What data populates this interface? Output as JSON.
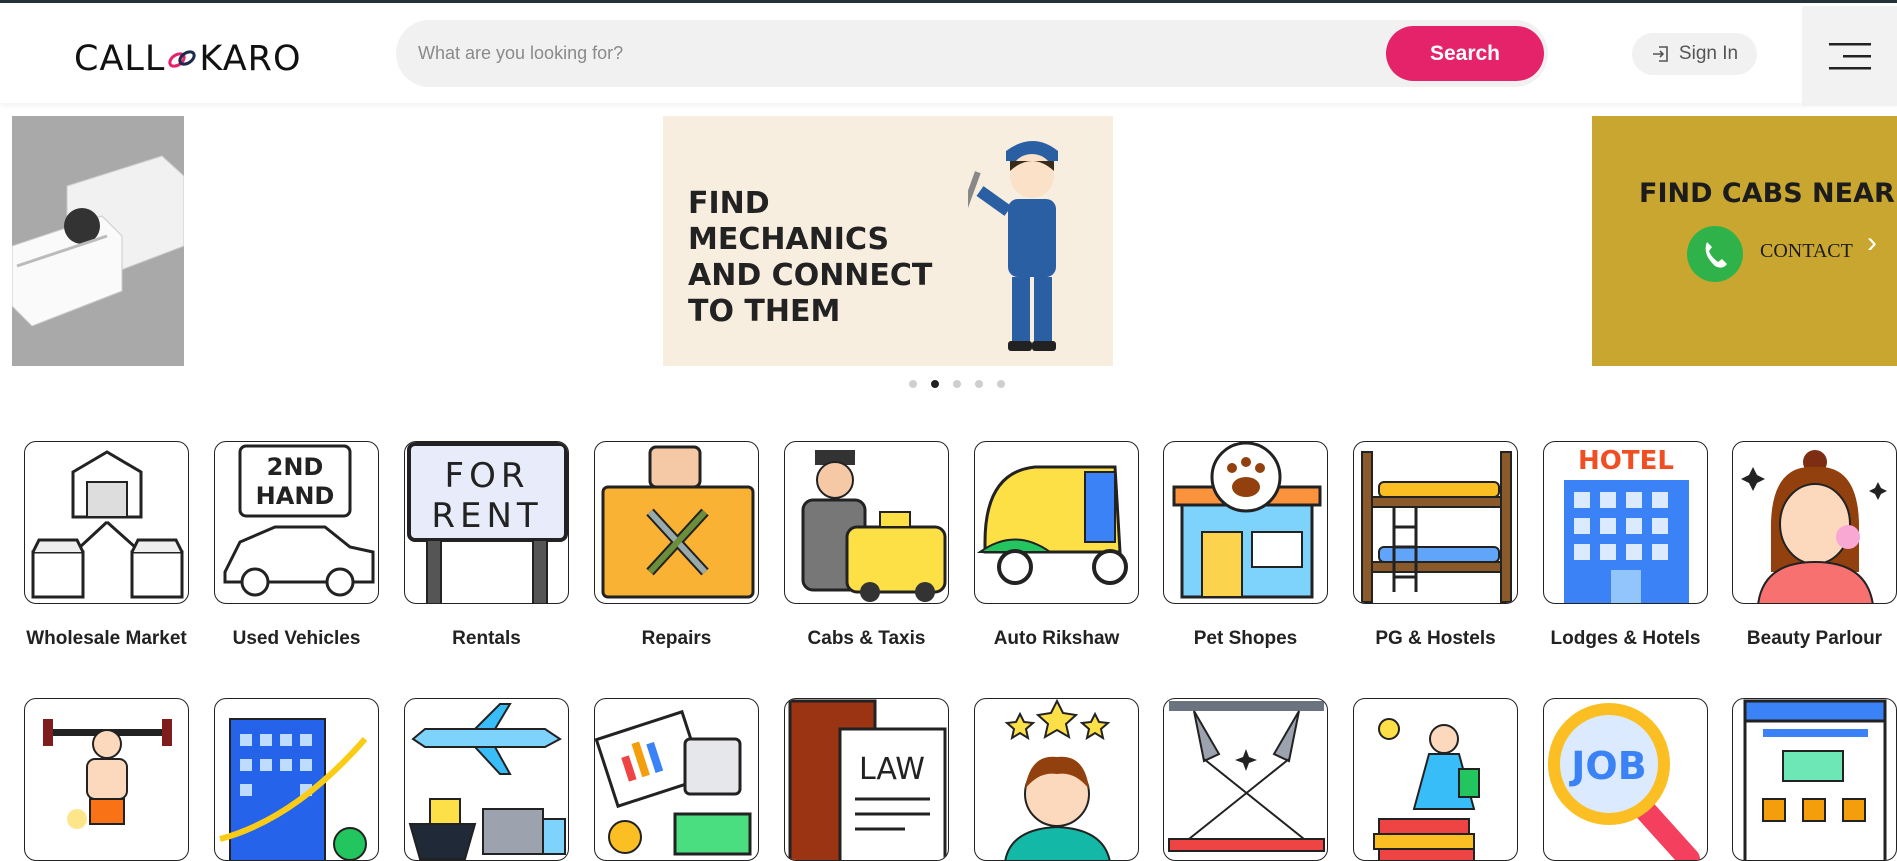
{
  "header": {
    "logo_left": "CALL",
    "logo_right": "KARO",
    "search_placeholder": "What are you looking for?",
    "search_button": "Search",
    "signin_label": "Sign In"
  },
  "banners": {
    "mechanics_text": "FIND MECHANICS AND CONNECT TO THEM",
    "cabs_text": "FIND CABS NEAR YO",
    "cabs_contact": "CONTACT"
  },
  "carousel": {
    "total": 5,
    "active": 2
  },
  "categories_row1": [
    {
      "label": "Wholesale Market",
      "icon": "warehouse-icon"
    },
    {
      "label": "Used Vehicles",
      "icon": "second-hand-car-icon"
    },
    {
      "label": "Rentals",
      "icon": "for-rent-sign-icon"
    },
    {
      "label": "Repairs",
      "icon": "toolbox-icon"
    },
    {
      "label": "Cabs & Taxis",
      "icon": "taxi-driver-icon"
    },
    {
      "label": "Auto Rikshaw",
      "icon": "auto-rickshaw-icon"
    },
    {
      "label": "Pet Shopes",
      "icon": "pet-shop-icon"
    },
    {
      "label": "PG & Hostels",
      "icon": "bunk-bed-icon"
    },
    {
      "label": "Lodges & Hotels",
      "icon": "hotel-icon"
    },
    {
      "label": "Beauty Parlour",
      "icon": "beauty-icon"
    }
  ],
  "categories_row2": [
    {
      "icon": "gym-icon"
    },
    {
      "icon": "real-estate-icon"
    },
    {
      "icon": "transport-icon"
    },
    {
      "icon": "accounting-icon"
    },
    {
      "icon": "law-book-icon",
      "text": "LAW"
    },
    {
      "icon": "doctor-icon"
    },
    {
      "icon": "event-lights-icon"
    },
    {
      "icon": "education-icon"
    },
    {
      "icon": "job-search-icon",
      "text": "JOB"
    },
    {
      "icon": "web-design-icon"
    }
  ],
  "icon_texts": {
    "second_hand_top": "2ND",
    "second_hand_bottom": "HAND",
    "for_rent_top": "FOR",
    "for_rent_bottom": "RENT",
    "hotel": "HOTEL"
  },
  "colors": {
    "accent": "#e5236b",
    "dark": "#263238"
  }
}
